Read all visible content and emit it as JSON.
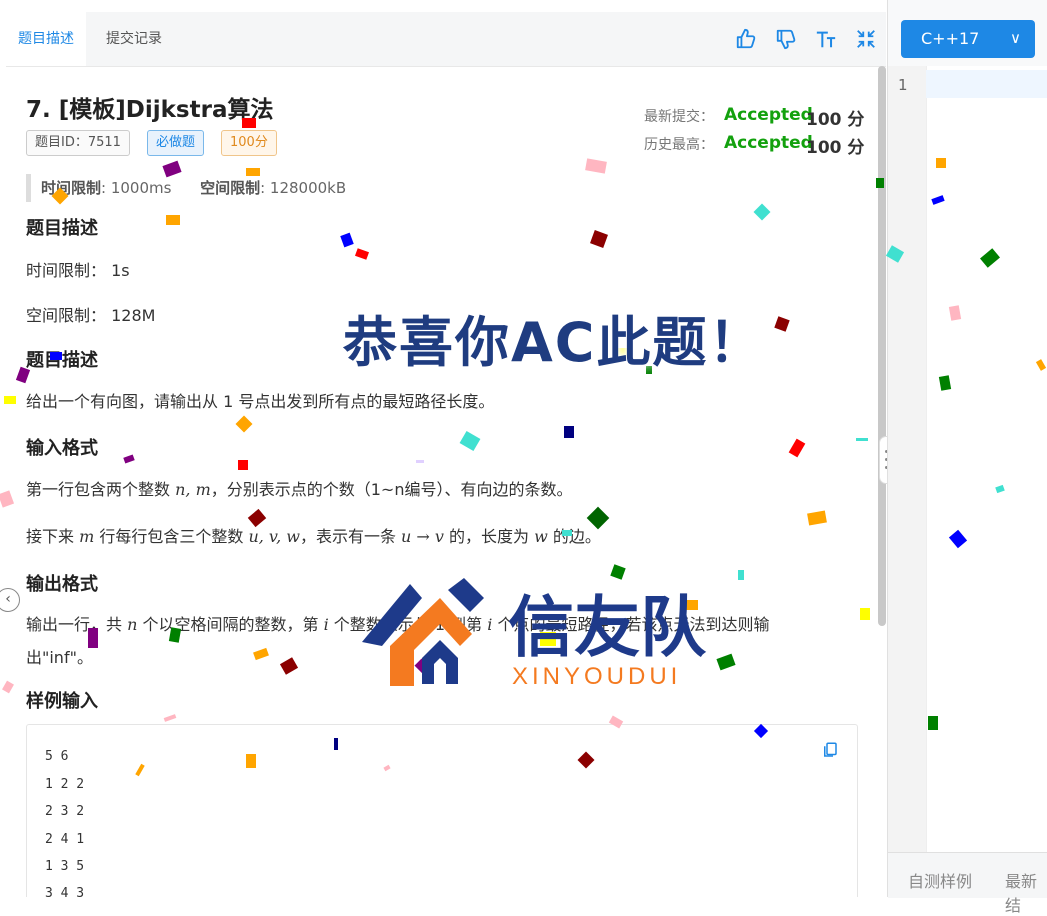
{
  "tabs": {
    "description": "题目描述",
    "submissions": "提交记录"
  },
  "toolbar_icons": [
    "thumbs-up-icon",
    "thumbs-down-icon",
    "font-size-icon",
    "collapse-icon"
  ],
  "problem": {
    "title": "7.  [模板]Dijkstra算法",
    "tag_id": "题目ID：7511",
    "tag_required": "必做题",
    "tag_score": "100分",
    "latest_label": "最新提交：",
    "latest_status": "Accepted",
    "latest_score": "100 分",
    "best_label": "历史最高：",
    "best_status": "Accepted",
    "best_score": "100 分",
    "time_label": "时间限制",
    "time_value": ": 1000ms",
    "mem_label": "空间限制",
    "mem_value": ": 128000kB"
  },
  "sections": {
    "desc_heading": "题目描述",
    "time_line": "时间限制：  1s",
    "mem_line": "空间限制：  128M",
    "desc_heading2": "题目描述",
    "desc_text": "给出一个有向图，请输出从 1 号点出发到所有点的最短路径长度。",
    "input_heading": "输入格式",
    "input_line1_a": "第一行包含两个整数 ",
    "input_line1_math": "n, m",
    "input_line1_b": "，分别表示点的个数（1~n编号）、有向边的条数。",
    "input_line2_a": "接下来 ",
    "input_line2_m": "m",
    "input_line2_b": " 行每行包含三个整数 ",
    "input_line2_math": "u, v, w",
    "input_line2_c": "，表示有一条 ",
    "input_line2_arrow": "u → v",
    "input_line2_d": " 的，长度为 ",
    "input_line2_w": "w",
    "input_line2_e": " 的边。",
    "output_heading": "输出格式",
    "output_a": "输出一行，共 ",
    "output_n": "n",
    "output_b": " 个以空格间隔的整数，第 ",
    "output_i": "i",
    "output_c": " 个整数表示从 1 到第 ",
    "output_i2": "i",
    "output_d": " 个点的最短路径，若该点无法到达则输",
    "output_e": "出\"inf\"。",
    "sample_heading": "样例输入",
    "sample_lines": [
      "5 6",
      "1 2 2",
      "2 3 2",
      "2 4 1",
      "1 3 5",
      "3 4 3"
    ]
  },
  "editor": {
    "language": "C++17",
    "line_number": "1"
  },
  "bottom_tabs": {
    "self_test": "自测样例",
    "latest": "最新结"
  },
  "overlay": {
    "congrats": "恭喜你AC此题！",
    "logo_cn": "信友队",
    "logo_en": "XINYOUDUI"
  },
  "colors": {
    "accent": "#1e88e5",
    "accepted": "#13a10e",
    "congrats": "#1f3c80",
    "logo_blue": "#1e3a8a",
    "logo_orange": "#f47a20"
  }
}
